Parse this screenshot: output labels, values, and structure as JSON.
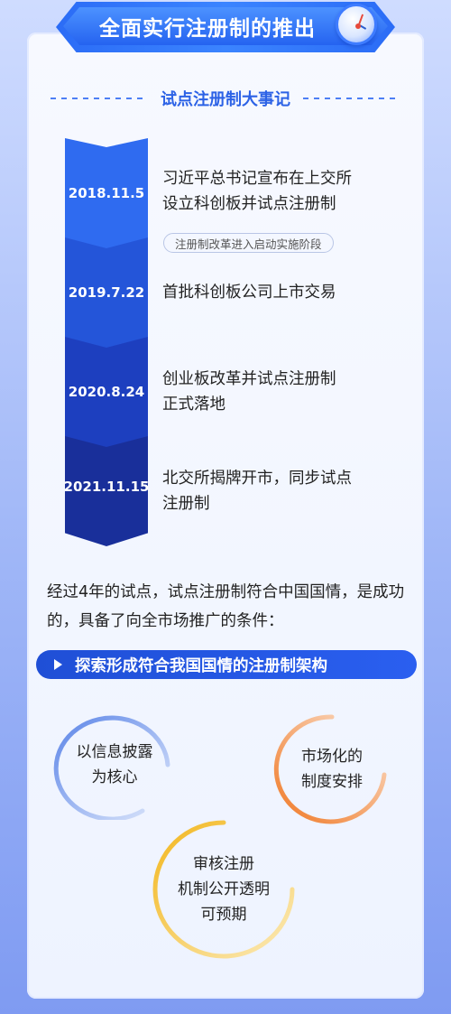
{
  "header": {
    "title": "全面实行注册制的推出"
  },
  "section": {
    "subtitle": "试点注册制大事记"
  },
  "timeline": [
    {
      "date": "2018.11.5",
      "text": "习近平总书记宣布在上交所\n设立科创板并试点注册制",
      "badge": "注册制改革进入启动实施阶段"
    },
    {
      "date": "2019.7.22",
      "text": "首批科创板公司上市交易"
    },
    {
      "date": "2020.8.24",
      "text": "创业板改革并试点注册制\n正式落地"
    },
    {
      "date": "2021.11.15",
      "text": "北交所揭牌开市，同步试点\n注册制"
    }
  ],
  "paragraph": "经过4年的试点，试点注册制符合中国国情，是成功的，具备了向全市场推广的条件：",
  "pill": {
    "label": "探索形成符合我国国情的注册制架构"
  },
  "circles": [
    {
      "label": "以信息披露\n为核心"
    },
    {
      "label": "市场化的\n制度安排"
    },
    {
      "label": "审核注册\n机制公开透明\n可预期"
    }
  ],
  "colors": {
    "primary": "#2b6cf6",
    "timeline": [
      "#2f6bf0",
      "#2455d9",
      "#1d3fbf",
      "#192f9a"
    ],
    "ring_blue": "#8fb0ef",
    "ring_orange": "#f08a3a",
    "ring_yellow": "#f4c43a"
  }
}
